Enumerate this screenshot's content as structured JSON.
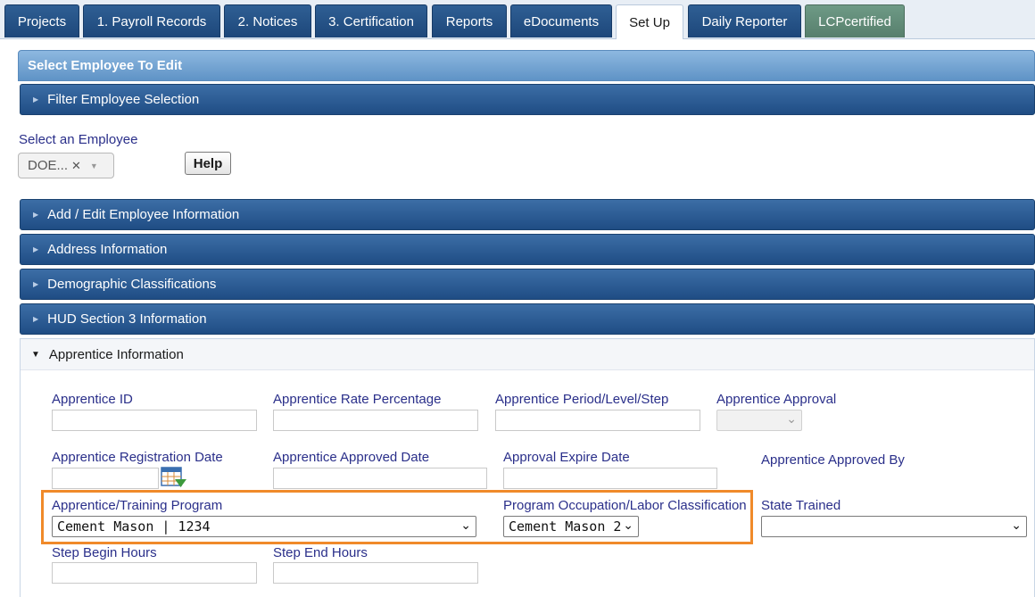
{
  "tabs": [
    {
      "label": "Projects"
    },
    {
      "label": "1. Payroll Records"
    },
    {
      "label": "2. Notices"
    },
    {
      "label": "3. Certification"
    },
    {
      "label": "Reports"
    },
    {
      "label": "eDocuments"
    },
    {
      "label": "Set Up",
      "active": true
    },
    {
      "label": "Daily Reporter"
    },
    {
      "label": "LCPcertified"
    }
  ],
  "header": {
    "title": "Select Employee To Edit"
  },
  "filter_bar": {
    "label": "Filter Employee Selection"
  },
  "employee_select": {
    "label": "Select an Employee",
    "value": "DOE...",
    "clear": "✕",
    "help_label": "Help"
  },
  "sections": [
    {
      "label": "Add / Edit Employee Information"
    },
    {
      "label": "Address Information"
    },
    {
      "label": "Demographic Classifications"
    },
    {
      "label": "HUD Section 3 Information"
    }
  ],
  "apprentice": {
    "heading": "Apprentice Information",
    "fields": {
      "apprentice_id": {
        "label": "Apprentice ID",
        "value": ""
      },
      "rate_percentage": {
        "label": "Apprentice Rate Percentage",
        "value": ""
      },
      "period_level_step": {
        "label": "Apprentice Period/Level/Step",
        "value": ""
      },
      "approval": {
        "label": "Apprentice Approval",
        "value": ""
      },
      "registration_date": {
        "label": "Apprentice Registration Date",
        "value": ""
      },
      "approved_date": {
        "label": "Apprentice Approved Date",
        "value": ""
      },
      "approval_expire_date": {
        "label": "Approval Expire Date",
        "value": ""
      },
      "approved_by": {
        "label": "Apprentice Approved By",
        "value": ""
      },
      "training_program": {
        "label": "Apprentice/Training Program",
        "value": "Cement Mason | 1234"
      },
      "occupation": {
        "label": "Program Occupation/Labor Classification",
        "value": "Cement Mason 2"
      },
      "state_trained": {
        "label": "State Trained",
        "value": ""
      },
      "step_begin_hours": {
        "label": "Step Begin Hours",
        "value": ""
      },
      "step_end_hours": {
        "label": "Step End Hours",
        "value": ""
      }
    }
  },
  "icons": {
    "dropdown": "chevron-down-icon",
    "calendar": "calendar-icon",
    "expand": "caret-right-icon",
    "collapse": "caret-down-icon"
  },
  "colors": {
    "tab_blue": "#1d477a",
    "tab_green": "#6e9a86",
    "section_blue": "#2a5a93",
    "label_navy": "#2a2f8a",
    "highlight_orange": "#f08a2a"
  }
}
